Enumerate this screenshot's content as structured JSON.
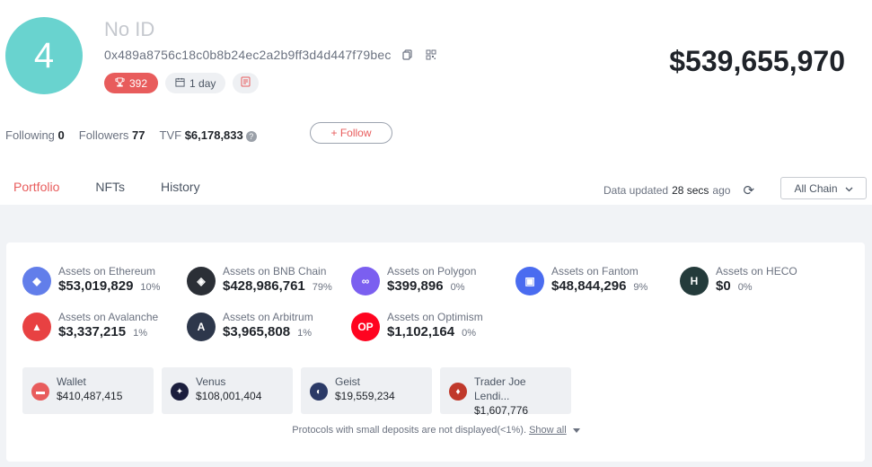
{
  "profile": {
    "avatar_text": "4",
    "name": "No ID",
    "address": "0x489a8756c18c0b8b24ec2a2b9ff3d4d447f79bec",
    "rank": "392",
    "period": "1 day",
    "total_value": "$539,655,970"
  },
  "social": {
    "following_label": "Following",
    "following_count": "0",
    "followers_label": "Followers",
    "followers_count": "77",
    "tvf_label": "TVF",
    "tvf_value": "$6,178,833",
    "follow_button": "+ Follow"
  },
  "tabs": [
    {
      "label": "Portfolio",
      "active": true
    },
    {
      "label": "NFTs",
      "active": false
    },
    {
      "label": "History",
      "active": false
    }
  ],
  "status": {
    "updated_prefix": "Data updated",
    "updated_time": "28 secs",
    "updated_suffix": "ago",
    "chain_filter": "All Chain"
  },
  "chains": [
    {
      "label": "Assets on Ethereum",
      "value": "$53,019,829",
      "pct": "10%",
      "color": "#627eea",
      "icon": "ethereum-icon",
      "glyph": "◆"
    },
    {
      "label": "Assets on BNB Chain",
      "value": "$428,986,761",
      "pct": "79%",
      "color": "#2b2f36",
      "icon": "bnb-icon",
      "glyph": "◈"
    },
    {
      "label": "Assets on Polygon",
      "value": "$399,896",
      "pct": "0%",
      "color": "#7b5ff0",
      "icon": "polygon-icon",
      "glyph": "∞"
    },
    {
      "label": "Assets on Fantom",
      "value": "$48,844,296",
      "pct": "9%",
      "color": "#4a6cf0",
      "icon": "fantom-icon",
      "glyph": "▣"
    },
    {
      "label": "Assets on HECO",
      "value": "$0",
      "pct": "0%",
      "color": "#243b3b",
      "icon": "heco-icon",
      "glyph": "H"
    },
    {
      "label": "Assets on Avalanche",
      "value": "$3,337,215",
      "pct": "1%",
      "color": "#e84142",
      "icon": "avalanche-icon",
      "glyph": "▲"
    },
    {
      "label": "Assets on Arbitrum",
      "value": "$3,965,808",
      "pct": "1%",
      "color": "#2d374b",
      "icon": "arbitrum-icon",
      "glyph": "A"
    },
    {
      "label": "Assets on Optimism",
      "value": "$1,102,164",
      "pct": "0%",
      "color": "#ff0420",
      "icon": "optimism-icon",
      "glyph": "OP"
    }
  ],
  "protocols": [
    {
      "name": "Wallet",
      "value": "$410,487,415",
      "color": "#e85c5c",
      "icon": "wallet-icon",
      "glyph": "▬"
    },
    {
      "name": "Venus",
      "value": "$108,001,404",
      "color": "#1b1e3d",
      "icon": "venus-icon",
      "glyph": "✦"
    },
    {
      "name": "Geist",
      "value": "$19,559,234",
      "color": "#2b3a67",
      "icon": "geist-icon",
      "glyph": "◐"
    },
    {
      "name": "Trader Joe Lendi...",
      "value": "$1,607,776",
      "color": "#c0392b",
      "icon": "trader-joe-icon",
      "glyph": "♦"
    }
  ],
  "footer_note": {
    "text": "Protocols with small deposits are not displayed(<1%).",
    "link": "Show all"
  }
}
